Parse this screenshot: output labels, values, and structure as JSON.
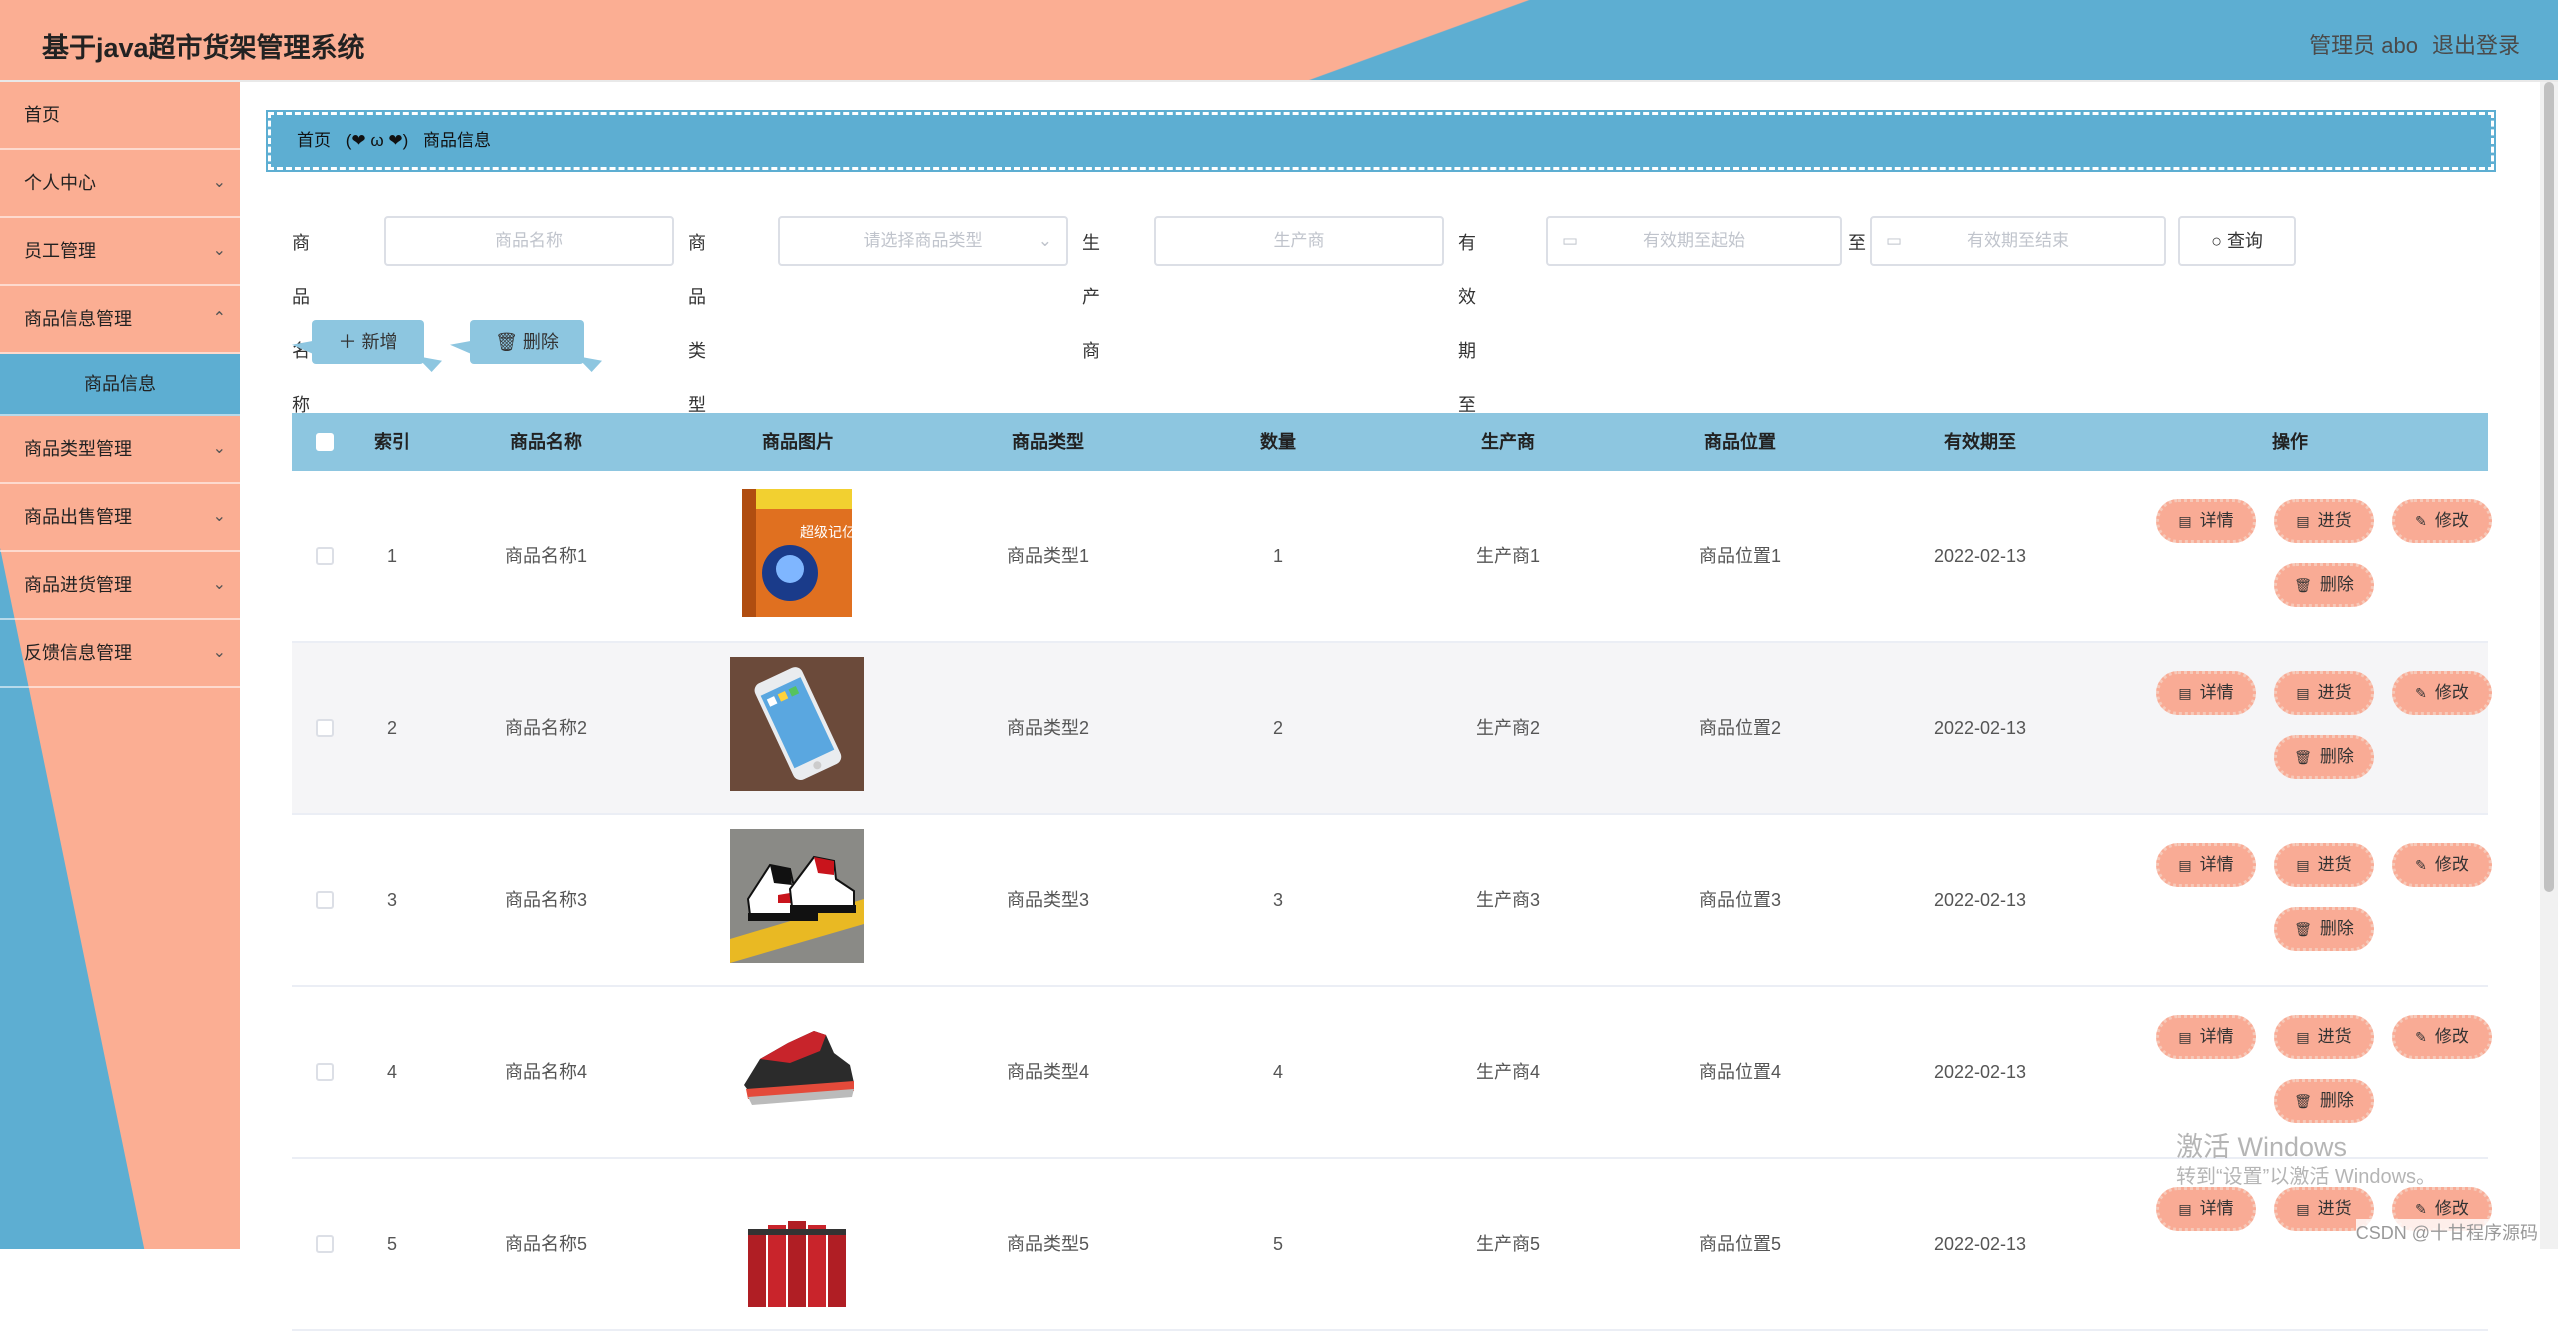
{
  "header": {
    "title": "基于java超市货架管理系统",
    "user": "管理员 abo",
    "logout": "退出登录"
  },
  "sidebar": {
    "items": [
      {
        "label": "首页"
      },
      {
        "label": "个人中心"
      },
      {
        "label": "员工管理"
      },
      {
        "label": "商品信息管理"
      },
      {
        "label": "商品信息"
      },
      {
        "label": "商品类型管理"
      },
      {
        "label": "商品出售管理"
      },
      {
        "label": "商品进货管理"
      },
      {
        "label": "反馈信息管理"
      }
    ]
  },
  "breadcrumb": {
    "home": "首页",
    "separator": "(❤ ω ❤)",
    "current": "商品信息"
  },
  "search": {
    "name_label": "商品名称",
    "name_placeholder": "商品名称",
    "type_label": "商品类型",
    "type_placeholder": "请选择商品类型",
    "maker_label": "生产商",
    "maker_placeholder": "生产商",
    "expiry_label": "有效期至",
    "expiry_start_placeholder": "有效期至起始",
    "to": "至",
    "expiry_end_placeholder": "有效期至结束",
    "query": "查询"
  },
  "actions": {
    "add": "新增",
    "delete": "删除"
  },
  "table": {
    "columns": [
      "索引",
      "商品名称",
      "商品图片",
      "商品类型",
      "数量",
      "生产商",
      "商品位置",
      "有效期至",
      "操作"
    ],
    "rows": [
      {
        "index": "1",
        "name": "商品名称1",
        "type": "商品类型1",
        "qty": "1",
        "maker": "生产商1",
        "location": "商品位置1",
        "expiry": "2022-02-13"
      },
      {
        "index": "2",
        "name": "商品名称2",
        "type": "商品类型2",
        "qty": "2",
        "maker": "生产商2",
        "location": "商品位置2",
        "expiry": "2022-02-13"
      },
      {
        "index": "3",
        "name": "商品名称3",
        "type": "商品类型3",
        "qty": "3",
        "maker": "生产商3",
        "location": "商品位置3",
        "expiry": "2022-02-13"
      },
      {
        "index": "4",
        "name": "商品名称4",
        "type": "商品类型4",
        "qty": "4",
        "maker": "生产商4",
        "location": "商品位置4",
        "expiry": "2022-02-13"
      },
      {
        "index": "5",
        "name": "商品名称5",
        "type": "商品类型5",
        "qty": "5",
        "maker": "生产商5",
        "location": "商品位置5",
        "expiry": "2022-02-13"
      }
    ],
    "ops": {
      "detail": "详情",
      "stock": "进货",
      "edit": "修改",
      "delete": "删除"
    }
  },
  "book_cover_text": "超级记亿术",
  "watermark": {
    "line1": "激活 Windows",
    "line2": "转到“设置”以激活 Windows。"
  },
  "csdn": "CSDN @十甘程序源码",
  "colors": {
    "accent_salmon": "#fbae93",
    "accent_blue": "#5daed2",
    "table_header": "#8dc6e0"
  }
}
